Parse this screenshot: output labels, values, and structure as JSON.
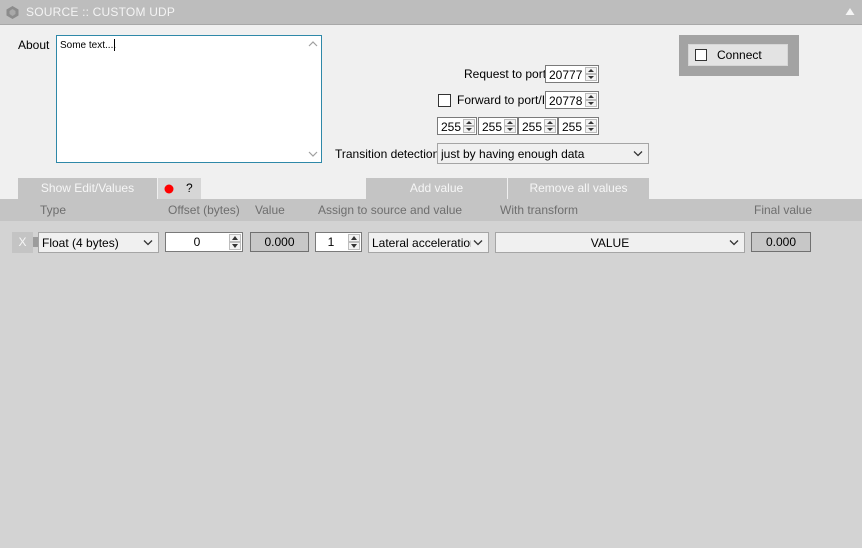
{
  "window": {
    "title": "SOURCE :: CUSTOM UDP"
  },
  "about": {
    "label": "About",
    "text": "Some text...."
  },
  "network": {
    "request_label": "Request to port",
    "request_port": "20777",
    "forward_label": "Forward to port/IP",
    "forward_checked": false,
    "forward_port": "20778",
    "ip": [
      "255",
      "255",
      "255",
      "255"
    ],
    "transition_label": "Transition detection",
    "transition_value": "just by having enough data"
  },
  "connect": {
    "label": "Connect",
    "checked": false
  },
  "tabs": {
    "show_edit": "Show Edit/Values",
    "help": "?",
    "add_value": "Add value",
    "remove_all": "Remove all values"
  },
  "columns": {
    "type": "Type",
    "offset": "Offset (bytes)",
    "value": "Value",
    "assign": "Assign to source and value",
    "transform": "With transform",
    "final": "Final value"
  },
  "rows": [
    {
      "remove": "X",
      "type": "Float (4 bytes)",
      "offset": "0",
      "value": "0.000",
      "index": "1",
      "assign": "Lateral acceleration (",
      "transform": "VALUE",
      "final": "0.000"
    }
  ],
  "colors": {
    "accent_border": "#2e88a8",
    "record_dot": "#ff0000",
    "panel_bg": "#f0f0f0",
    "workspace_bg": "#d3d3d3"
  }
}
